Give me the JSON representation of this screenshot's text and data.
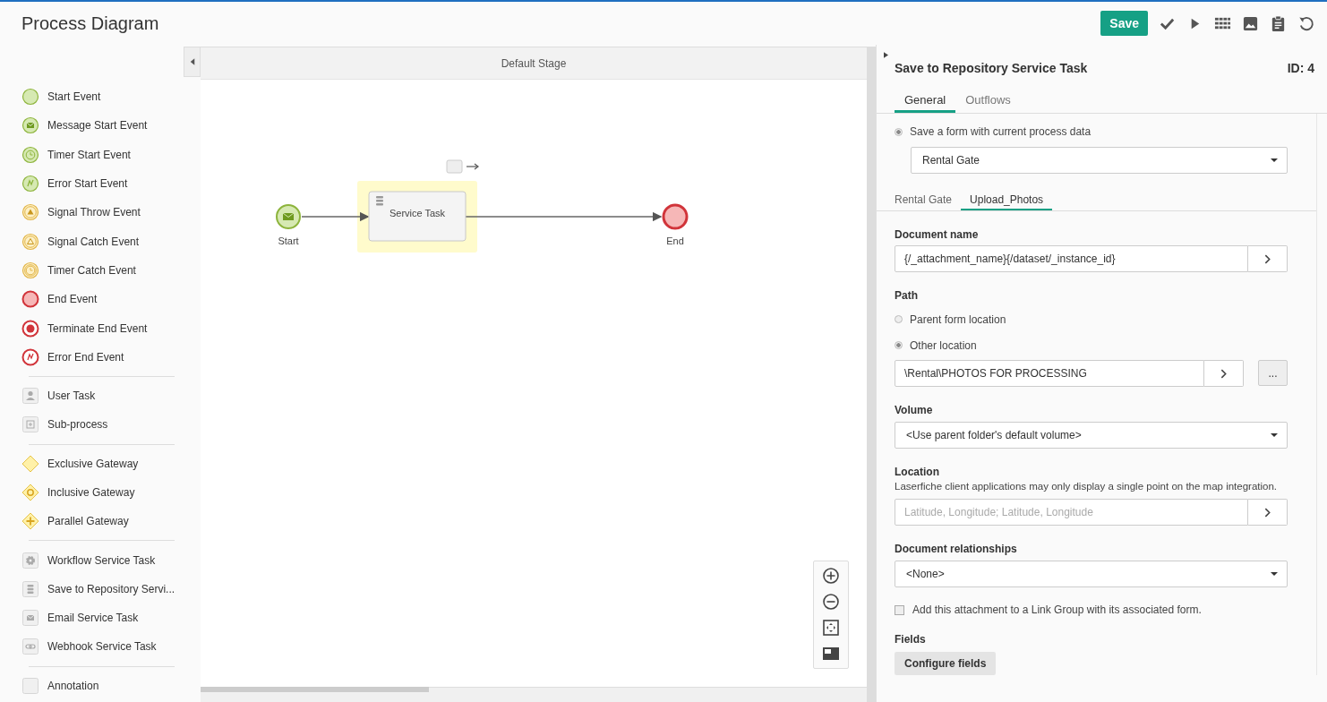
{
  "header": {
    "title": "Process Diagram",
    "save": "Save"
  },
  "palette": {
    "groups": [
      {
        "items": [
          {
            "label": "Start Event",
            "kind": "start"
          },
          {
            "label": "Message Start Event",
            "kind": "message-start"
          },
          {
            "label": "Timer Start Event",
            "kind": "timer-start"
          },
          {
            "label": "Error Start Event",
            "kind": "error-start"
          },
          {
            "label": "Signal Throw Event",
            "kind": "signal-throw"
          },
          {
            "label": "Signal Catch Event",
            "kind": "signal-catch"
          },
          {
            "label": "Timer Catch Event",
            "kind": "timer-catch"
          },
          {
            "label": "End Event",
            "kind": "end"
          },
          {
            "label": "Terminate End Event",
            "kind": "terminate-end"
          },
          {
            "label": "Error End Event",
            "kind": "error-end"
          }
        ]
      },
      {
        "items": [
          {
            "label": "User Task",
            "kind": "user-task"
          },
          {
            "label": "Sub-process",
            "kind": "sub-process"
          }
        ]
      },
      {
        "items": [
          {
            "label": "Exclusive Gateway",
            "kind": "exclusive"
          },
          {
            "label": "Inclusive Gateway",
            "kind": "inclusive"
          },
          {
            "label": "Parallel Gateway",
            "kind": "parallel"
          }
        ]
      },
      {
        "items": [
          {
            "label": "Workflow Service Task",
            "kind": "workflow"
          },
          {
            "label": "Save to Repository Servi...",
            "kind": "repository"
          },
          {
            "label": "Email Service Task",
            "kind": "email"
          },
          {
            "label": "Webhook Service Task",
            "kind": "webhook"
          }
        ]
      },
      {
        "items": [
          {
            "label": "Annotation",
            "kind": "annotation"
          }
        ]
      }
    ]
  },
  "canvas": {
    "stage": "Default Stage",
    "nodes": [
      {
        "kind": "message-start",
        "label": "Start",
        "selected": false
      },
      {
        "kind": "service-task",
        "label": "Service Task",
        "selected": true
      },
      {
        "kind": "end",
        "label": "End",
        "selected": false
      }
    ]
  },
  "panel": {
    "title": "Save to Repository Service Task",
    "id": "ID: 4",
    "tabs": [
      {
        "label": "General",
        "selected": true
      },
      {
        "label": "Outflows",
        "selected": false
      }
    ],
    "save_option": {
      "label": "Save a form with current process data",
      "selected": true
    },
    "form_select": "Rental Gate",
    "form_tabs": [
      {
        "label": "Rental Gate",
        "selected": false
      },
      {
        "label": "Upload_Photos",
        "selected": true
      }
    ],
    "document_name": {
      "label": "Document name",
      "value": "{/_attachment_name}{/dataset/_instance_id}"
    },
    "path": {
      "label": "Path",
      "options": [
        {
          "label": "Parent form location",
          "selected": false
        },
        {
          "label": "Other location",
          "selected": true
        }
      ],
      "value": "\\Rental\\PHOTOS FOR PROCESSING",
      "browse": "..."
    },
    "volume": {
      "label": "Volume",
      "value": "<Use parent folder's default volume>"
    },
    "location": {
      "label": "Location",
      "help": "Laserfiche client applications may only display a single point on the map integration.",
      "placeholder": "Latitude, Longitude; Latitude, Longitude"
    },
    "relationships": {
      "label": "Document relationships",
      "value": "<None>"
    },
    "link_group": {
      "label": "Add this attachment to a Link Group with its associated form.",
      "checked": false
    },
    "fields": {
      "label": "Fields",
      "button": "Configure fields"
    }
  }
}
